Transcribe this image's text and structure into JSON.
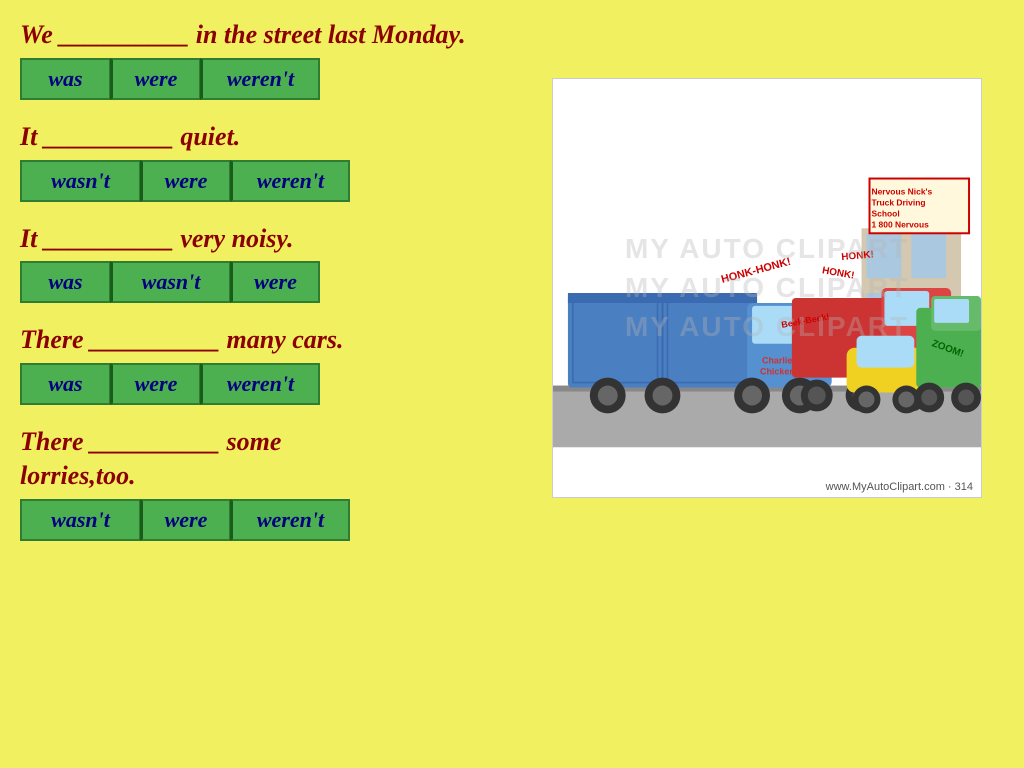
{
  "background_color": "#f0f060",
  "questions": [
    {
      "id": "q1",
      "text": "We __________ in the street last Monday.",
      "options": [
        "was",
        "were",
        "weren't"
      ]
    },
    {
      "id": "q2",
      "text": "It __________ quiet.",
      "options": [
        "wasn't",
        "were",
        "weren't"
      ]
    },
    {
      "id": "q3",
      "text": "It __________ very noisy.",
      "options": [
        "was",
        "wasn't",
        "were"
      ]
    },
    {
      "id": "q4",
      "text": "There __________ many cars.",
      "options": [
        "was",
        "were",
        "weren't"
      ]
    },
    {
      "id": "q5",
      "text": "There __________ some lorries,too.",
      "options": [
        "wasn't",
        "were",
        "weren't"
      ]
    }
  ],
  "clipart": {
    "watermark_line1": "MY AUTO CLIPART",
    "watermark_line2": "MY AUTO CLIPART",
    "watermark_line3": "MY AUTO CLIPART",
    "caption": "www.MyAutoClipart.com · 314"
  }
}
